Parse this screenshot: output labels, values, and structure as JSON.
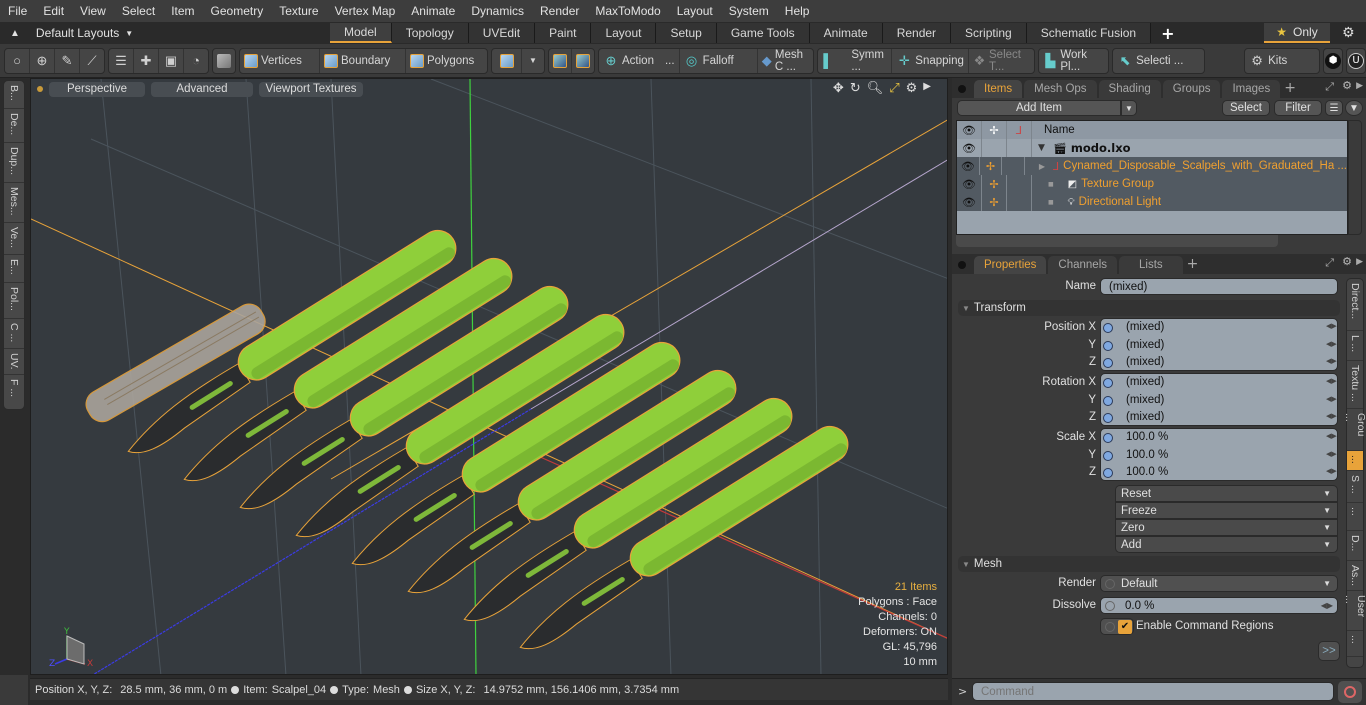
{
  "menu": [
    "File",
    "Edit",
    "View",
    "Select",
    "Item",
    "Geometry",
    "Texture",
    "Vertex Map",
    "Animate",
    "Dynamics",
    "Render",
    "MaxToModo",
    "Layout",
    "System",
    "Help"
  ],
  "layout_selector": "Default Layouts",
  "layout_tabs": [
    {
      "label": "Model",
      "active": true
    },
    {
      "label": "Topology"
    },
    {
      "label": "UVEdit"
    },
    {
      "label": "Paint"
    },
    {
      "label": "Layout"
    },
    {
      "label": "Setup"
    },
    {
      "label": "Game Tools"
    },
    {
      "label": "Animate"
    },
    {
      "label": "Render"
    },
    {
      "label": "Scripting"
    },
    {
      "label": "Schematic Fusion"
    }
  ],
  "only_label": "Only",
  "toolbar": {
    "vertices": "Vertices",
    "boundary": "Boundary",
    "polygons": "Polygons",
    "action": "Action",
    "falloff": "Falloff",
    "mesh_c": "Mesh C ...",
    "symm": "Symm ...",
    "snapping": "Snapping",
    "select_t": "Select T...",
    "work_pl": "Work Pl...",
    "selecti": "Selecti ...",
    "kits": "Kits",
    "ellipsis": "..."
  },
  "left_tabs": [
    "B...",
    "De...",
    "Dup...",
    "Mes...",
    "Ve...",
    "E...",
    "Pol...",
    "C ...",
    "UV.",
    "F ..."
  ],
  "viewport": {
    "perspective": "Perspective",
    "advanced": "Advanced",
    "viewport_textures": "Viewport Textures",
    "info": {
      "items": "21 Items",
      "polygons": "Polygons : Face",
      "channels": "Channels: 0",
      "deformers": "Deformers: ON",
      "gl": "GL: 45,796",
      "scale": "10 mm"
    },
    "axis": {
      "x": "X",
      "y": "Y",
      "z": "Z"
    }
  },
  "status": {
    "position_label": "Position X, Y, Z:",
    "position_value": "28.5 mm, 36 mm, 0 m",
    "item_label": "Item:",
    "item_value": "Scalpel_04",
    "type_label": "Type:",
    "type_value": "Mesh",
    "size_label": "Size X, Y, Z:",
    "size_value": "14.9752 mm, 156.1406 mm, 3.7354 mm"
  },
  "items_panel": {
    "tabs": [
      {
        "label": "Items",
        "active": true
      },
      {
        "label": "Mesh Ops"
      },
      {
        "label": "Shading"
      },
      {
        "label": "Groups"
      },
      {
        "label": "Images"
      }
    ],
    "add_item": "Add Item",
    "select": "Select",
    "filter": "Filter",
    "name_header": "Name",
    "rows": [
      {
        "name": "modo.lxo",
        "type": "scene"
      },
      {
        "name": "Cynamed_Disposable_Scalpels_with_Graduated_Ha ...",
        "type": "mesh-group"
      },
      {
        "name": "Texture Group",
        "type": "texture"
      },
      {
        "name": "Directional Light",
        "type": "light"
      }
    ]
  },
  "properties_panel": {
    "tabs": [
      {
        "label": "Properties",
        "active": true
      },
      {
        "label": "Channels"
      },
      {
        "label": "Lists"
      }
    ],
    "name_label": "Name",
    "name_value": "(mixed)",
    "transform_section": "Transform",
    "position": {
      "label": "Position X",
      "x": "(mixed)",
      "y": "(mixed)",
      "z": "(mixed)"
    },
    "rotation": {
      "label": "Rotation X",
      "x": "(mixed)",
      "y": "(mixed)",
      "z": "(mixed)"
    },
    "scale": {
      "label": "Scale X",
      "x": "100.0 %",
      "y": "100.0 %",
      "z": "100.0 %"
    },
    "axis_y": "Y",
    "axis_z": "Z",
    "actions": [
      "Reset",
      "Freeze",
      "Zero",
      "Add"
    ],
    "mesh_section": "Mesh",
    "render_label": "Render",
    "render_value": "Default",
    "dissolve_label": "Dissolve",
    "dissolve_value": "0.0 %",
    "enable_cmd_regions": "Enable Command Regions",
    "enable_cmd_regions_checked": true,
    "more": ">>",
    "side_tabs": [
      "Direct...",
      "L ...",
      "Textu ...",
      "Grou ...",
      "...",
      "S ...",
      "...",
      "D...",
      "As...",
      "User ...",
      "..."
    ]
  },
  "command": {
    "prompt": ">",
    "placeholder": "Command"
  },
  "colors": {
    "accent": "#e8a33a",
    "selection": "#f0a030",
    "mesh_green": "#8fcf3a",
    "grid_bg": "#353a3f"
  }
}
